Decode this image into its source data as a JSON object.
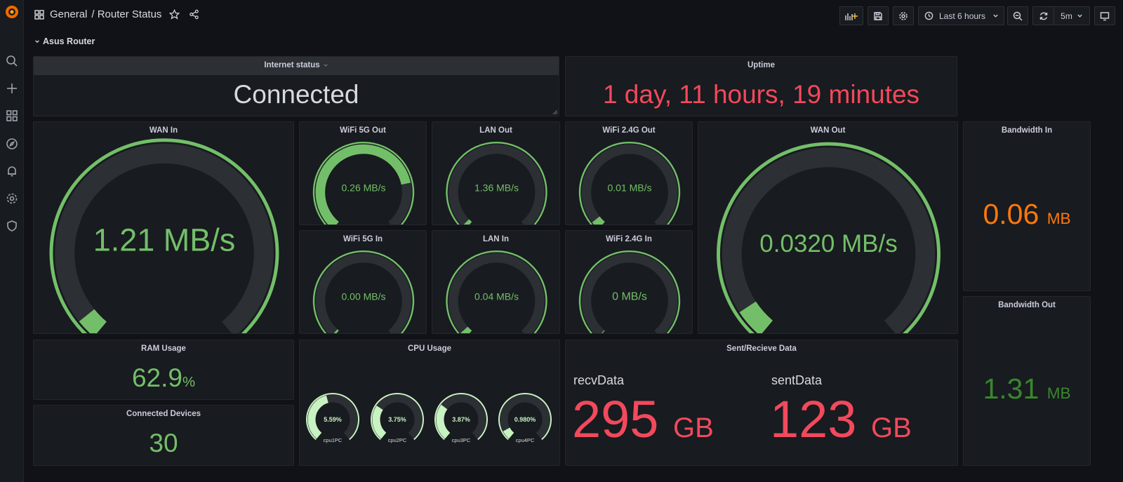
{
  "breadcrumb": {
    "folder": "General",
    "dashboard": "/ Router Status"
  },
  "toolbar": {
    "time_range": "Last 6 hours",
    "refresh_interval": "5m"
  },
  "row": {
    "title": "Asus Router"
  },
  "colors": {
    "green": "#73bf69",
    "red": "#f2495c",
    "orange": "#ff780a",
    "dark_green": "#37872d",
    "track": "#2c3035",
    "light_green": "#c8f2c2"
  },
  "panels": {
    "internet_status": {
      "title": "Internet status",
      "value": "Connected"
    },
    "uptime": {
      "title": "Uptime",
      "value": "1 day, 11 hours, 19 minutes"
    },
    "wan_in": {
      "title": "WAN In",
      "value": "1.21 MB/s",
      "fraction": 0.04
    },
    "wifi5g_out": {
      "title": "WiFi 5G Out",
      "value": "0.26 MB/s",
      "fraction": 0.78
    },
    "lan_out": {
      "title": "LAN Out",
      "value": "1.36 MB/s",
      "fraction": 0.02
    },
    "wifi24g_out": {
      "title": "WiFi 2.4G Out",
      "value": "0.01 MB/s",
      "fraction": 0.04
    },
    "wan_out": {
      "title": "WAN Out",
      "value": "0.0320 MB/s",
      "fraction": 0.06
    },
    "bandwidth_in": {
      "title": "Bandwidth In",
      "value": "0.06",
      "unit": "MB"
    },
    "wifi5g_in": {
      "title": "WiFi 5G In",
      "value": "0.00 MB/s",
      "fraction": 0.01
    },
    "lan_in": {
      "title": "LAN In",
      "value": "0.04 MB/s",
      "fraction": 0.03
    },
    "wifi24g_in": {
      "title": "WiFi 2.4G In",
      "value": "0 MB/s",
      "fraction": 0.0
    },
    "bandwidth_out": {
      "title": "Bandwidth Out",
      "value": "1.31",
      "unit": "MB"
    },
    "ram": {
      "title": "RAM Usage",
      "value": "62.9",
      "unit": "%"
    },
    "devices": {
      "title": "Connected Devices",
      "value": "30"
    },
    "cpu": {
      "title": "CPU Usage",
      "cores": [
        {
          "label": "cpu1PC",
          "value": "5.59%",
          "fraction": 0.0559
        },
        {
          "label": "cpu2PC",
          "value": "3.75%",
          "fraction": 0.0375
        },
        {
          "label": "cpu3PC",
          "value": "3.87%",
          "fraction": 0.0387
        },
        {
          "label": "cpu4PC",
          "value": "0.980%",
          "fraction": 0.0098
        }
      ]
    },
    "sent_recv": {
      "title": "Sent/Recieve Data",
      "recv": {
        "label": "recvData",
        "value": "295",
        "unit": "GB"
      },
      "sent": {
        "label": "sentData",
        "value": "123",
        "unit": "GB"
      }
    }
  }
}
